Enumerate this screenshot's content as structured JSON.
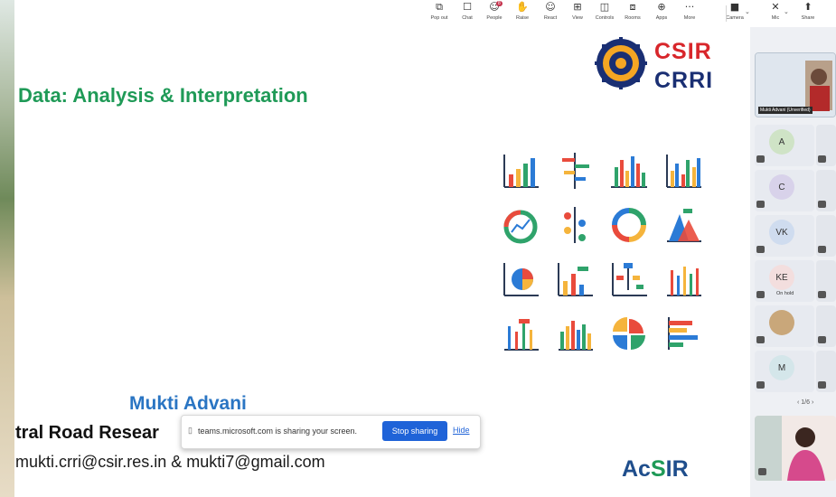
{
  "toolbar": {
    "buttons": [
      {
        "label": "Pop out",
        "icon": "pop-out-icon",
        "glyph": "⧉"
      },
      {
        "label": "Chat",
        "icon": "chat-icon",
        "glyph": "☐"
      },
      {
        "label": "People",
        "icon": "people-icon",
        "glyph": "☺",
        "badge": "8"
      },
      {
        "label": "Raise",
        "icon": "hand-icon",
        "glyph": "✋"
      },
      {
        "label": "React",
        "icon": "react-icon",
        "glyph": "☺"
      },
      {
        "label": "View",
        "icon": "view-icon",
        "glyph": "⊞"
      },
      {
        "label": "Controls",
        "icon": "controls-icon",
        "glyph": "◫"
      },
      {
        "label": "Rooms",
        "icon": "rooms-icon",
        "glyph": "⧈"
      },
      {
        "label": "Apps",
        "icon": "apps-icon",
        "glyph": "⊕"
      },
      {
        "label": "More",
        "icon": "more-icon",
        "glyph": "···"
      },
      {
        "label": "Camera",
        "icon": "camera-icon",
        "glyph": "■"
      },
      {
        "label": "Mic",
        "icon": "mic-off-icon",
        "glyph": "✕"
      },
      {
        "label": "Share",
        "icon": "share-icon",
        "glyph": "⬆"
      }
    ]
  },
  "slide": {
    "title": "Data: Analysis & Interpretation",
    "logo_top": "CSIR",
    "logo_bottom": "CRRI",
    "speaker": "Mukti Advani",
    "org": "tral Road Resear",
    "email": "mukti.crri@csir.res.in & mukti7@gmail.com",
    "acsir_a": "Ac",
    "acsir_y": "S",
    "acsir_b": "IR"
  },
  "share_bar": {
    "message": "teams.microsoft.com is sharing your screen.",
    "stop_label": "Stop sharing",
    "hide_label": "Hide"
  },
  "participants": {
    "main_name": "Mukti Advani (Unverified)",
    "tiles": [
      {
        "initials": "A",
        "color": "#cfe3c6",
        "status": ""
      },
      {
        "initials": "C",
        "color": "#d8d2ea",
        "status": ""
      },
      {
        "initials": "VK",
        "color": "#cfdcef",
        "status": ""
      },
      {
        "initials": "KE",
        "color": "#f3dede",
        "status": "On hold"
      },
      {
        "initials": "",
        "color": "#c9a77a",
        "status": ""
      },
      {
        "initials": "M",
        "color": "#d4e6ea",
        "status": ""
      }
    ],
    "page_label": "1/6"
  },
  "colors": {
    "title_green": "#1f9a57",
    "speaker_blue": "#2a75c3",
    "stop_blue": "#1f63d8"
  }
}
